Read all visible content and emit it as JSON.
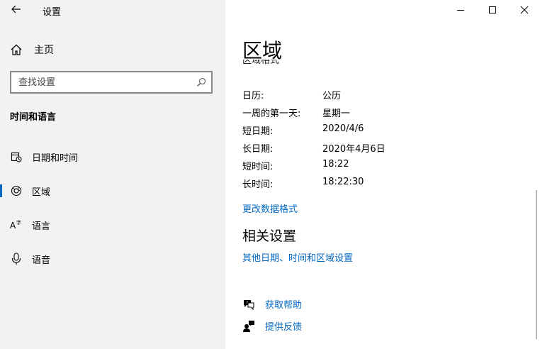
{
  "window": {
    "title": "设置",
    "controls": {
      "minimize": "minimize-icon",
      "maximize": "maximize-icon",
      "close": "close-icon"
    }
  },
  "sidebar": {
    "home_label": "主页",
    "search": {
      "placeholder": "查找设置",
      "icon": "search-icon"
    },
    "section_heading": "时间和语言",
    "items": [
      {
        "label": "日期和时间",
        "icon": "calendar-clock-icon",
        "selected": false
      },
      {
        "label": "区域",
        "icon": "globe-icon",
        "selected": true
      },
      {
        "label": "语言",
        "icon": "language-icon",
        "selected": false
      },
      {
        "label": "语音",
        "icon": "microphone-icon",
        "selected": false
      }
    ],
    "accent_color": "#0067c0"
  },
  "main": {
    "title": "区域",
    "clipped_text": "区域格式",
    "formats": [
      {
        "key": "日历:",
        "value": "公历"
      },
      {
        "key": "一周的第一天:",
        "value": "星期一"
      },
      {
        "key": "短日期:",
        "value": "2020/4/6"
      },
      {
        "key": "长日期:",
        "value": "2020年4月6日"
      },
      {
        "key": "短时间:",
        "value": "18:22"
      },
      {
        "key": "长时间:",
        "value": "18:22:30"
      }
    ],
    "change_format_link": "更改数据格式",
    "related_heading": "相关设置",
    "related_link": "其他日期、时间和区域设置",
    "help": [
      {
        "label": "获取帮助",
        "icon": "help-chat-icon"
      },
      {
        "label": "提供反馈",
        "icon": "feedback-icon"
      }
    ],
    "link_color": "#0067c0"
  },
  "annotation": {
    "arrow_color": "#e53935"
  }
}
